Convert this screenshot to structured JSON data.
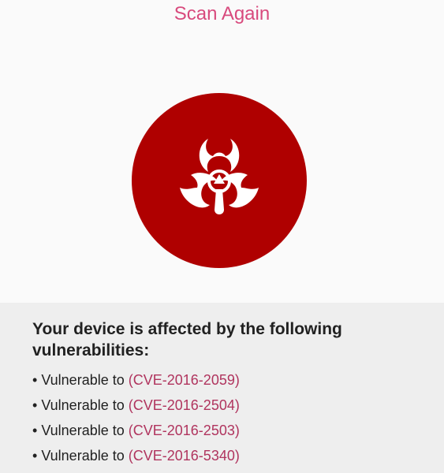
{
  "header": {
    "scan_again_label": "Scan Again"
  },
  "status": {
    "icon": "biohazard-icon",
    "circle_color": "#af0000",
    "accent_color": "#d84a7d",
    "link_color": "#b0345e"
  },
  "results": {
    "heading": "Your device is affected by the following vulnerabilities:",
    "items": [
      {
        "bullet": "•",
        "prefix": "Vulnerable to",
        "cve": "(CVE-2016-2059)"
      },
      {
        "bullet": "•",
        "prefix": "Vulnerable to",
        "cve": "(CVE-2016-2504)"
      },
      {
        "bullet": "•",
        "prefix": "Vulnerable to",
        "cve": "(CVE-2016-2503)"
      },
      {
        "bullet": "•",
        "prefix": "Vulnerable to",
        "cve": "(CVE-2016-5340)"
      }
    ]
  }
}
